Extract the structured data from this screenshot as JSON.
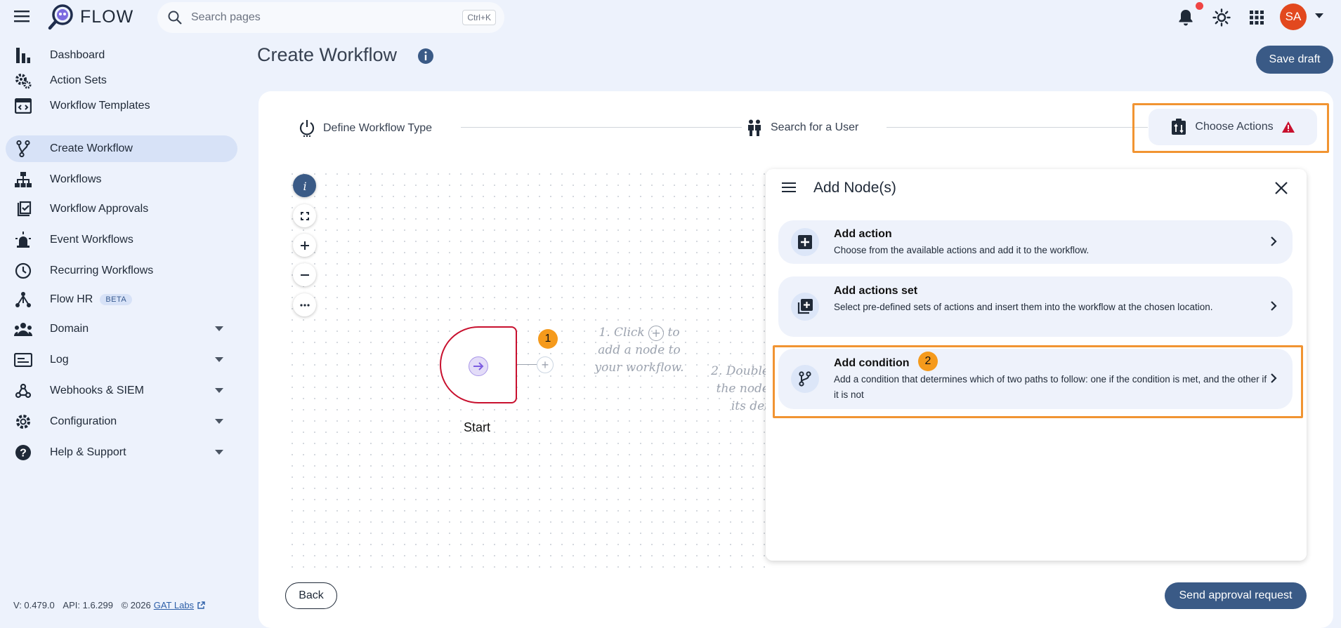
{
  "app": {
    "name": "FLOW"
  },
  "search": {
    "placeholder": "Search pages",
    "shortcut": "Ctrl+K"
  },
  "user": {
    "initials": "SA"
  },
  "sidebar": {
    "items": [
      {
        "label": "Dashboard"
      },
      {
        "label": "Action Sets"
      },
      {
        "label": "Workflow Templates"
      },
      {
        "label": "Create Workflow"
      },
      {
        "label": "Workflows"
      },
      {
        "label": "Workflow Approvals"
      },
      {
        "label": "Event Workflows"
      },
      {
        "label": "Recurring Workflows"
      },
      {
        "label": "Flow HR",
        "badge": "BETA"
      },
      {
        "label": "Domain"
      },
      {
        "label": "Log"
      },
      {
        "label": "Webhooks & SIEM"
      },
      {
        "label": "Configuration"
      },
      {
        "label": "Help & Support"
      }
    ]
  },
  "footer": {
    "version": "V: 0.479.0",
    "api": "API: 1.6.299",
    "copyright": "© 2026",
    "link": "GAT Labs"
  },
  "page": {
    "title": "Create Workflow",
    "save_draft": "Save draft"
  },
  "steps": [
    {
      "label": "Define Workflow Type"
    },
    {
      "label": "Search for a User"
    },
    {
      "label": "Choose Actions"
    }
  ],
  "canvas": {
    "start_label": "Start",
    "badge1": "1",
    "hint1_line1": "1. Click",
    "hint1_line1b": "to",
    "hint1_line2": "add a node to",
    "hint1_line3": "your workflow.",
    "hint2_line1": "2. Double",
    "hint2_line2": "the node",
    "hint2_line3": "its det"
  },
  "panel": {
    "title": "Add Node(s)",
    "options": [
      {
        "title": "Add action",
        "desc": "Choose from the available actions and add it to the workflow."
      },
      {
        "title": "Add actions set",
        "desc": "Select pre-defined sets of actions and insert them into the workflow at the chosen location."
      },
      {
        "title": "Add condition",
        "desc": "Add a condition that determines which of two paths to follow: one if the condition is met, and the other if it is not",
        "badge": "2"
      }
    ]
  },
  "buttons": {
    "back": "Back",
    "send": "Send approval request"
  },
  "colors": {
    "primary": "#3a5a86",
    "highlight": "#f19432",
    "badge": "#f59a1c",
    "avatar": "#e2481e",
    "start_border": "#c8102e"
  }
}
